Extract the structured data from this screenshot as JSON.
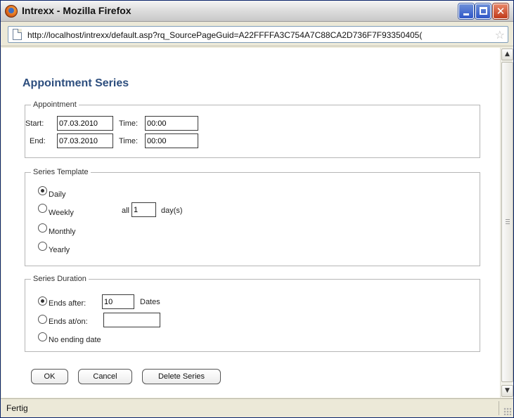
{
  "window": {
    "title": "Intrexx - Mozilla Firefox"
  },
  "address": {
    "url": "http://localhost/intrexx/default.asp?rq_SourcePageGuid=A22FFFFA3C754A7C88CA2D736F7F93350405("
  },
  "page": {
    "title": "Appointment Series"
  },
  "appointment": {
    "legend": "Appointment",
    "start_label": "Start:",
    "end_label": "End:",
    "time_label": "Time:",
    "start_date": "07.03.2010",
    "start_time": "00:00",
    "end_date": "07.03.2010",
    "end_time": "00:00"
  },
  "template": {
    "legend": "Series Template",
    "options": [
      "Daily",
      "Weekly",
      "Monthly",
      "Yearly"
    ],
    "selected": "Daily",
    "interval_prefix": "all",
    "interval_value": "1",
    "interval_suffix": "day(s)"
  },
  "duration": {
    "legend": "Series Duration",
    "ends_after_label": "Ends after:",
    "ends_after_value": "10",
    "dates_label": "Dates",
    "ends_on_label": "Ends at/on:",
    "ends_on_value": "",
    "no_end_label": "No ending date",
    "selected": "Ends after:"
  },
  "buttons": {
    "ok": "OK",
    "cancel": "Cancel",
    "delete": "Delete Series"
  },
  "status": {
    "text": "Fertig"
  }
}
